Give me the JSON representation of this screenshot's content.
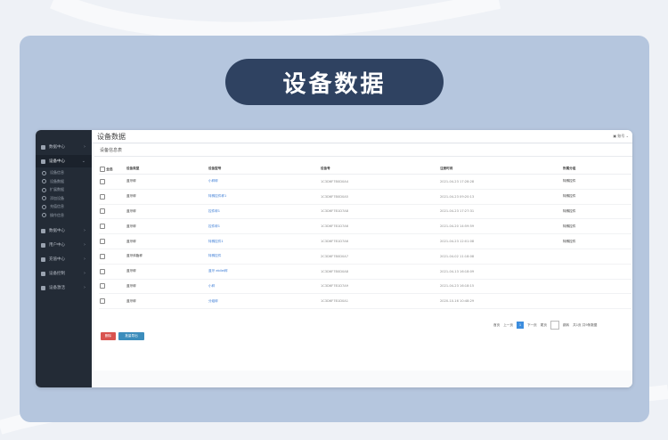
{
  "banner": {
    "title": "设备数据"
  },
  "app": {
    "page_title": "设备数据",
    "topbar_right": "▣ 账号 ⌄",
    "panel_title": "设备信息表",
    "sidebar": [
      {
        "label": "数据中心",
        "icon": "dashboard-icon",
        "active": false
      },
      {
        "label": "设备中心",
        "icon": "device-icon",
        "active": true
      },
      {
        "label": "数据中心",
        "icon": "chart-icon",
        "active": false
      },
      {
        "label": "用户中心",
        "icon": "user-icon",
        "active": false
      },
      {
        "label": "充值中心",
        "icon": "yen-icon",
        "active": false
      },
      {
        "label": "设备控制",
        "icon": "control-icon",
        "active": false
      },
      {
        "label": "设备激活",
        "icon": "activate-icon",
        "active": false
      }
    ],
    "sidebar_sub": [
      "设备信息",
      "设备数据",
      "扩展数据",
      "添加设备",
      "充值信息",
      "操作信息"
    ],
    "table": {
      "headers": [
        "全选",
        "设备类型",
        "设备型号",
        "设备号",
        "注册时间",
        "所属分组"
      ],
      "rows": [
        {
          "type": "蓝牙秤",
          "model": "小秤秤",
          "sn": "1C3D6F7B0D0A4",
          "time": "2021-04-23 17:28:28",
          "group": "特殊控件"
        },
        {
          "type": "蓝牙秤",
          "model": "特殊控件秤1",
          "sn": "1C3D6F7B0D0A5",
          "time": "2021-04-23 09:20:13",
          "group": "特殊控件"
        },
        {
          "type": "蓝牙秤",
          "model": "控件秤1",
          "sn": "1C3D6F7B1D7A8",
          "time": "2021-04-23 17:27:31",
          "group": "特殊控件"
        },
        {
          "type": "蓝牙秤",
          "model": "控件秤1",
          "sn": "1C3D6F7B1D7A6",
          "time": "2021-04-20 14:59:59",
          "group": "特殊控件"
        },
        {
          "type": "蓝牙秤",
          "model": "特殊控件1",
          "sn": "1C3D6F7B1D7A6",
          "time": "2021-04-23 12:01:08",
          "group": "特殊控件"
        },
        {
          "type": "蓝牙体脂秤",
          "model": "特殊控件",
          "sn": "2C3D6F7B0D0A7",
          "time": "2021-04-02 11:18:08",
          "group": ""
        },
        {
          "type": "蓝牙秤",
          "model": "蓝牙 ebilei秤",
          "sn": "1C3D6F7B0D0A8",
          "time": "2021-04-13 16:18:09",
          "group": ""
        },
        {
          "type": "蓝牙秤",
          "model": "小秤",
          "sn": "1C3D6F7B1D7A9",
          "time": "2021-04-23 16:18:15",
          "group": ""
        },
        {
          "type": "蓝牙秤",
          "model": "分组秤",
          "sn": "1C3D6F7B1D0A1",
          "time": "2020-10-16 10:48:29",
          "group": ""
        }
      ]
    },
    "pager": {
      "first": "首页",
      "prev": "上一页",
      "current": "1",
      "next": "下一页",
      "last": "尾页",
      "go": "跳转",
      "info": "共1页 共9条数据"
    },
    "buttons": {
      "delete": "删除",
      "export": "批量导出"
    }
  }
}
